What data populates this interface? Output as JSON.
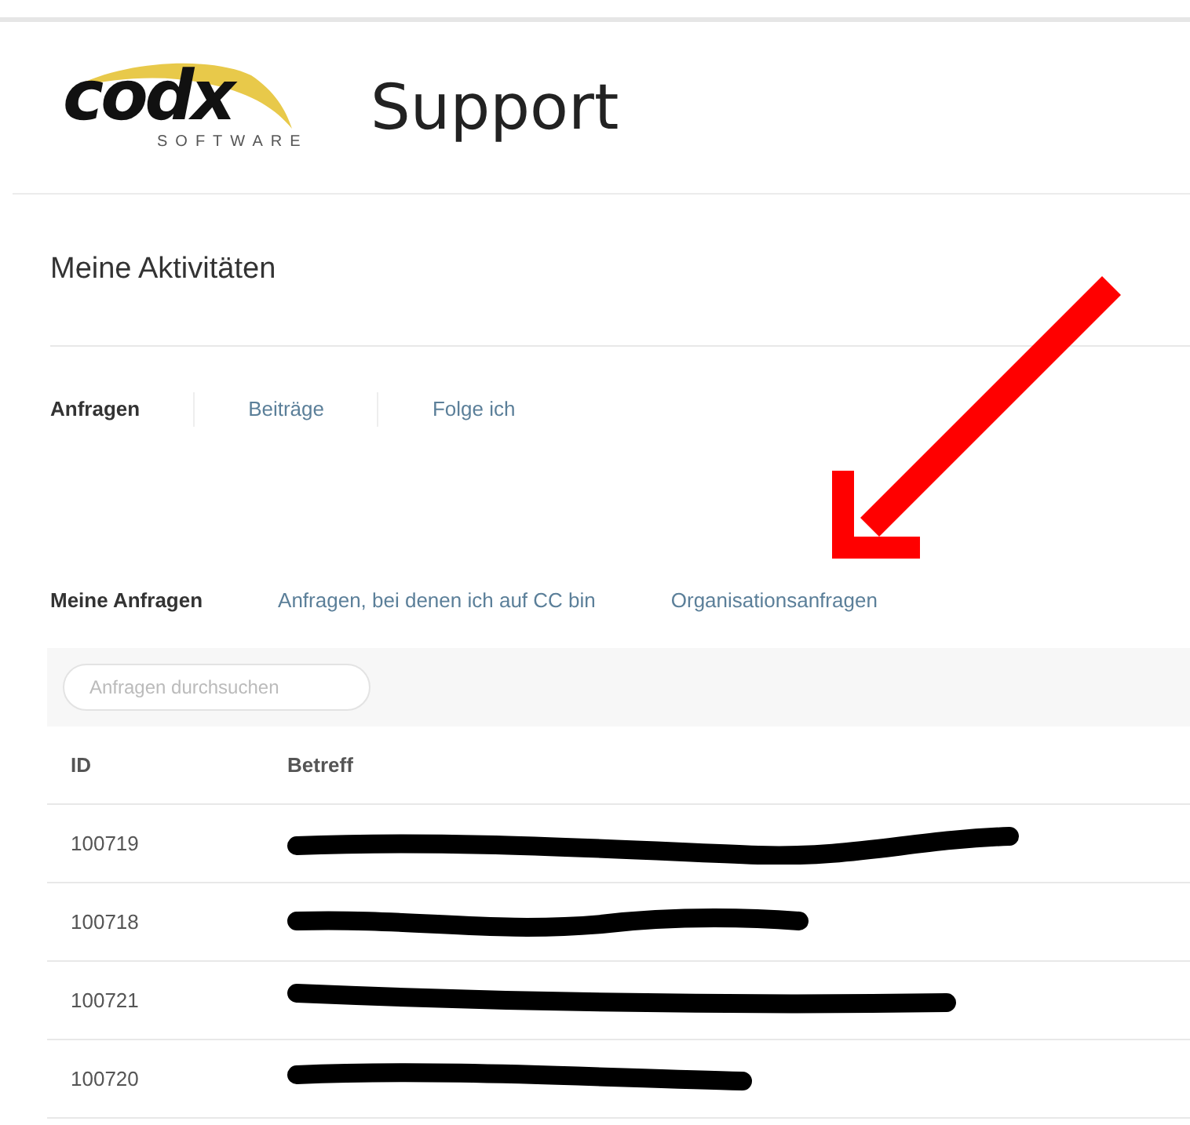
{
  "header": {
    "logo_word": "codx",
    "logo_sub": "SOFTWARE",
    "title": "Support"
  },
  "page_title": "Meine Aktivitäten",
  "tabs": [
    {
      "label": "Anfragen",
      "selected": true
    },
    {
      "label": "Beiträge",
      "selected": false
    },
    {
      "label": "Folge ich",
      "selected": false
    }
  ],
  "sub_tabs": [
    {
      "label": "Meine Anfragen",
      "selected": true
    },
    {
      "label": "Anfragen, bei denen ich auf CC bin",
      "selected": false
    },
    {
      "label": "Organisationsanfragen",
      "selected": false
    }
  ],
  "search": {
    "placeholder": "Anfragen durchsuchen"
  },
  "table": {
    "columns": [
      "ID",
      "Betreff"
    ],
    "rows": [
      {
        "id": "100719",
        "subject_redacted": true
      },
      {
        "id": "100718",
        "subject_redacted": true
      },
      {
        "id": "100721",
        "subject_redacted": true
      },
      {
        "id": "100720",
        "subject_redacted": true
      }
    ]
  },
  "annotation": {
    "kind": "arrow"
  }
}
